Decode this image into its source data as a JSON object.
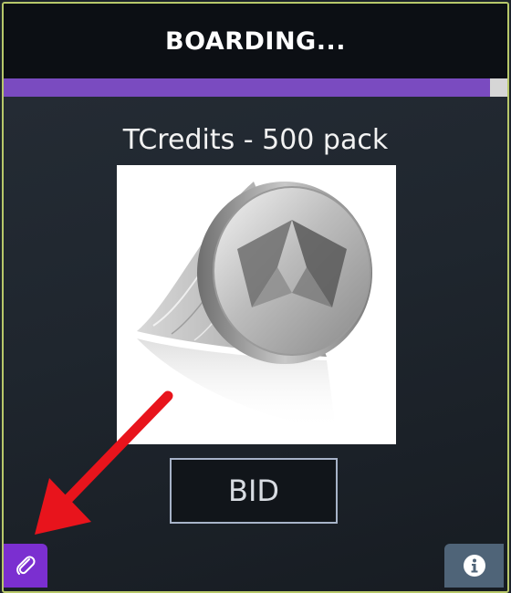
{
  "header": {
    "title": "BOARDING..."
  },
  "progress": {
    "fraction": 0.965,
    "fill_color": "#7a4bc0",
    "track_color": "#d6d6d6"
  },
  "item": {
    "title": "TCredits - 500 pack",
    "image_icon": "silver-coin-stack"
  },
  "actions": {
    "bid_label": "BID"
  },
  "footer": {
    "left_icon": "paperclip-icon",
    "right_icon": "info-icon"
  },
  "annotation": {
    "arrow_color": "#e8141c"
  }
}
